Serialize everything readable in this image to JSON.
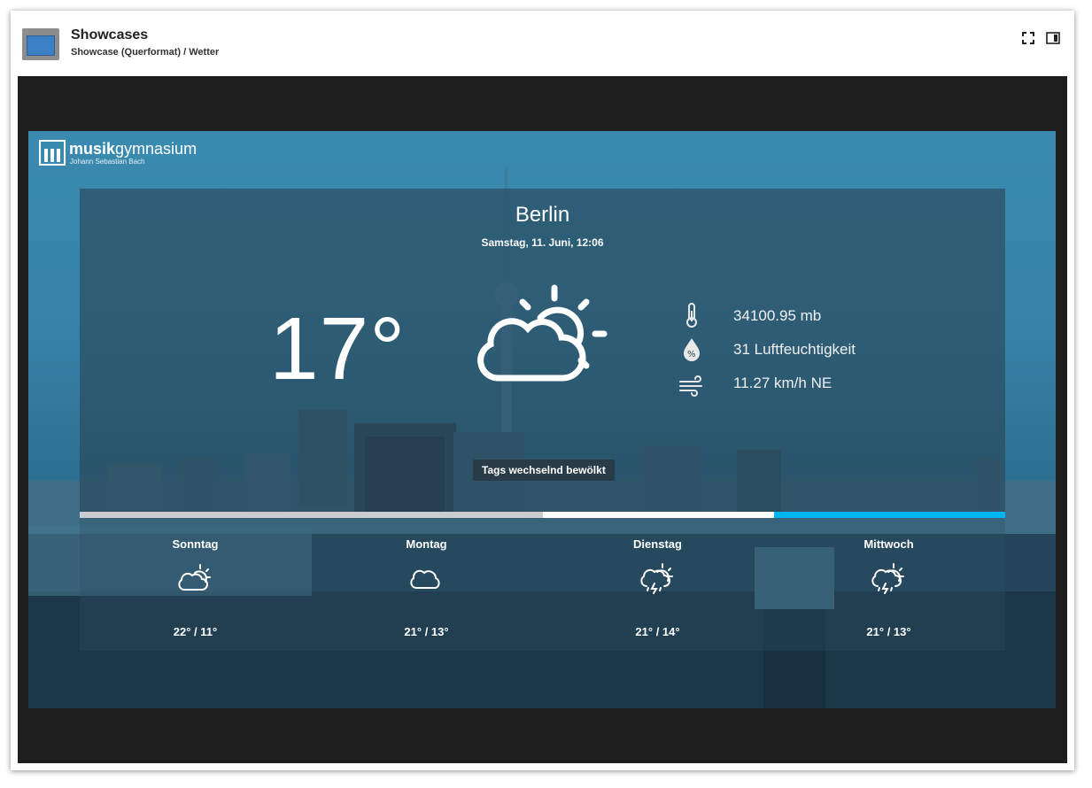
{
  "header": {
    "title": "Showcases",
    "breadcrumb": "Showcase (Querformat) / Wetter",
    "icons": [
      "fullscreen-icon",
      "side-panel-icon"
    ]
  },
  "logo": {
    "name_bold": "musik",
    "name_regular": "gymnasium",
    "subtitle": "Johann Sebastian Bach"
  },
  "weather": {
    "city": "Berlin",
    "datetime": "Samstag, 11. Juni, 12:06",
    "temperature": "17°",
    "condition": "Tags wechselnd bewölkt",
    "pressure": "34100.95 mb",
    "humidity": "31 Luftfeuchtigkeit",
    "wind": "11.27 km/h NE",
    "icons": [
      "partly-cloudy-icon",
      "thermometer-icon",
      "humidity-icon",
      "wind-icon"
    ]
  },
  "progress": {
    "segments": [
      {
        "color": "#c9cdd0",
        "share": 0.5
      },
      {
        "color": "#ffffff",
        "share": 0.25
      },
      {
        "color": "#00b6f0",
        "share": 0.25
      }
    ]
  },
  "forecast": [
    {
      "day": "Sonntag",
      "range": "22° / 11°",
      "icon": "partly-cloudy-icon"
    },
    {
      "day": "Montag",
      "range": "21° / 13°",
      "icon": "cloudy-icon"
    },
    {
      "day": "Dienstag",
      "range": "21° / 14°",
      "icon": "thunderstorm-icon"
    },
    {
      "day": "Mittwoch",
      "range": "21° / 13°",
      "icon": "thunderstorm-icon"
    }
  ],
  "colors": {
    "panel_bg": "#284655",
    "display_bg": "#3a8ab0",
    "frame_bg": "#1e1e1e",
    "accent": "#00b6f0"
  }
}
